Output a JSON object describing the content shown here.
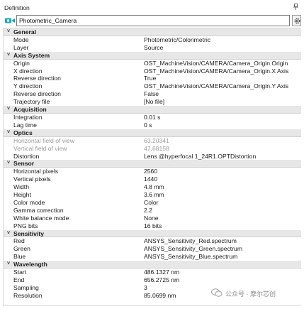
{
  "panel": {
    "title": "Definition",
    "pin_icon": "pin-icon"
  },
  "object_name": {
    "value": "Photometric_Camera",
    "icon": "camera-icon",
    "settings_icon": "gear-icon"
  },
  "groups": [
    {
      "label": "General",
      "rows": [
        {
          "name": "Mode",
          "value": "Photometric/Colorimetric"
        },
        {
          "name": "Layer",
          "value": "Source"
        }
      ]
    },
    {
      "label": "Axis System",
      "rows": [
        {
          "name": "Origin",
          "value": "OST_MachineVision/CAMERA/Camera_Origin.Origin"
        },
        {
          "name": "X direction",
          "value": "OST_MachineVision/CAMERA/Camera_Origin.X Axis"
        },
        {
          "name": "Reverse direction",
          "value": "True"
        },
        {
          "name": "Y direction",
          "value": "OST_MachineVision/CAMERA/Camera_Origin.Y Axis"
        },
        {
          "name": "Reverse direction",
          "value": "False"
        },
        {
          "name": "Trajectory file",
          "value": "[No file]"
        }
      ]
    },
    {
      "label": "Acquisition",
      "rows": [
        {
          "name": "Integration",
          "value": "0.01 s"
        },
        {
          "name": "Lag time",
          "value": "0 s"
        }
      ]
    },
    {
      "label": "Optics",
      "rows": [
        {
          "name": "Horizontal field of view",
          "value": "63.20341",
          "readonly": true
        },
        {
          "name": "Vertical field of view",
          "value": "47.68158",
          "readonly": true
        },
        {
          "name": "Distortion",
          "value": "Lens @hyperfocal 1_24R1.OPTDistortion"
        }
      ]
    },
    {
      "label": "Sensor",
      "rows": [
        {
          "name": "Horizontal pixels",
          "value": "2560"
        },
        {
          "name": "Vertical pixels",
          "value": "1440"
        },
        {
          "name": "Width",
          "value": "4.8 mm"
        },
        {
          "name": "Height",
          "value": "3.6 mm"
        },
        {
          "name": "Color mode",
          "value": "Color"
        },
        {
          "name": "Gamma correction",
          "value": "2.2"
        },
        {
          "name": "White balance mode",
          "value": "None"
        },
        {
          "name": "PNG bits",
          "value": "16 bits"
        }
      ]
    },
    {
      "label": "Sensitivity",
      "rows": [
        {
          "name": "Red",
          "value": "ANSYS_Sensitivity_Red.spectrum"
        },
        {
          "name": "Green",
          "value": "ANSYS_Sensitivity_Green.spectrum"
        },
        {
          "name": "Blue",
          "value": "ANSYS_Sensitivity_Blue.spectrum"
        }
      ]
    },
    {
      "label": "Wavelength",
      "rows": [
        {
          "name": "Start",
          "value": "486.1327 nm"
        },
        {
          "name": "End",
          "value": "656.2725 nm"
        },
        {
          "name": "Sampling",
          "value": "3"
        },
        {
          "name": "Resolution",
          "value": "85.0699 nm"
        }
      ]
    }
  ],
  "watermark": {
    "text": "公众号 · 摩尔芯创",
    "icon": "wechat-icon"
  },
  "colors": {
    "camera_icon": "#16a8b8",
    "category_bg": "#e7e7e7",
    "readonly_text": "#9b9b9b"
  }
}
